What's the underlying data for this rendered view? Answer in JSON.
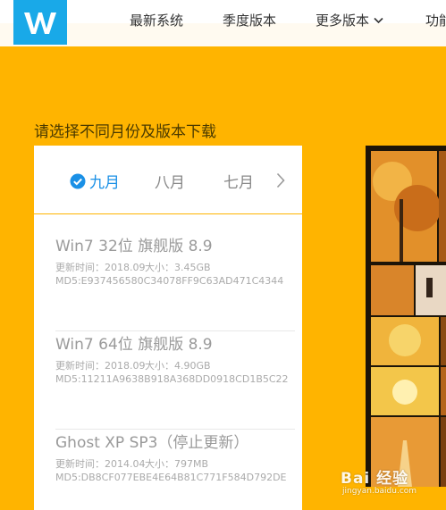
{
  "nav": {
    "items": [
      "最新系统",
      "季度版本",
      "更多版本",
      "功能"
    ]
  },
  "section": {
    "title": "请选择不同月份及版本下载"
  },
  "months": {
    "tabs": [
      "九月",
      "八月",
      "七月"
    ],
    "active_index": 0
  },
  "versions": [
    {
      "name": "Win7 32位 旗舰版 8.9",
      "update": "更新时间：2018.09",
      "size": "大小：3.45GB",
      "md5": "MD5:E937456580C34078FF9C63AD471C4344"
    },
    {
      "name": "Win7 64位 旗舰版 8.9",
      "update": "更新时间：2018.09",
      "size": "大小：4.90GB",
      "md5": "MD5:11211A9638B918A368DD0918CD1B5C22"
    },
    {
      "name": "Ghost XP SP3（停止更新）",
      "update": "更新时间：2014.04",
      "size": "大小：797MB",
      "md5": "MD5:DB8CF077EBE4E64B81C771F584D792DE"
    }
  ],
  "watermark": {
    "brand": "Bai 经验",
    "url": "jingyan.baidu.com"
  },
  "colors": {
    "background": "#ffb400",
    "logo": "#19a9e8",
    "active_tab": "#1a90e6"
  },
  "icons": {
    "logo": "w-logo-icon",
    "check": "check-circle-icon",
    "dropdown": "chevron-down-icon",
    "next": "chevron-right-icon"
  }
}
